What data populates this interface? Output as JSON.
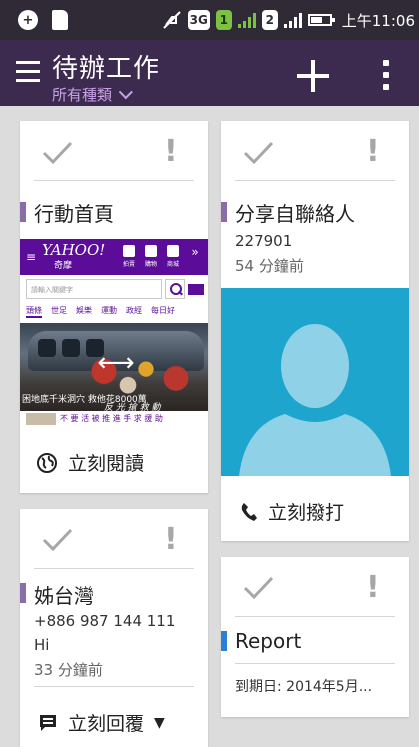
{
  "status_bar": {
    "network_3g": "3G",
    "sim1": "1",
    "sim2": "2",
    "time": "上午11:06"
  },
  "app_bar": {
    "title": "待辦工作",
    "filter": "所有種類"
  },
  "cards": [
    {
      "heading": "行動首頁",
      "action": "立刻閱讀",
      "thumbnail": {
        "logo": "YAHOO!",
        "logo_sub": "奇摩",
        "icons": [
          "拍賣",
          "購物",
          "商城"
        ],
        "search_placeholder": "請輸入關鍵字",
        "tabs": [
          "頭條",
          "世足",
          "娛樂",
          "運動",
          "政經",
          "每日好"
        ],
        "caption": "困地底千米洞穴 救他花8000萬",
        "stamp": "反 光 搶 救 動",
        "footer": "不 要 活 被 推 進 手 求 援 助"
      }
    },
    {
      "heading": "分享自聯絡人",
      "line1": "227901",
      "line2": "54 分鐘前",
      "action": "立刻撥打"
    },
    {
      "heading": "姊台灣",
      "line1": "+886 987 144 111",
      "line2": "Hi",
      "line3": "33 分鐘前",
      "action": "立刻回覆"
    },
    {
      "heading": "Report",
      "line1": "到期日: 2014年5月...",
      "accent": "#2a7fd6"
    }
  ],
  "colors": {
    "appbar": "#3d2a4f",
    "statusbar": "#2f2a36",
    "accent_purple": "#8a6ca6",
    "accent_blue": "#2a7fd6",
    "filter_text": "#c9a2e8",
    "contact_bg": "#1ea5ce"
  }
}
